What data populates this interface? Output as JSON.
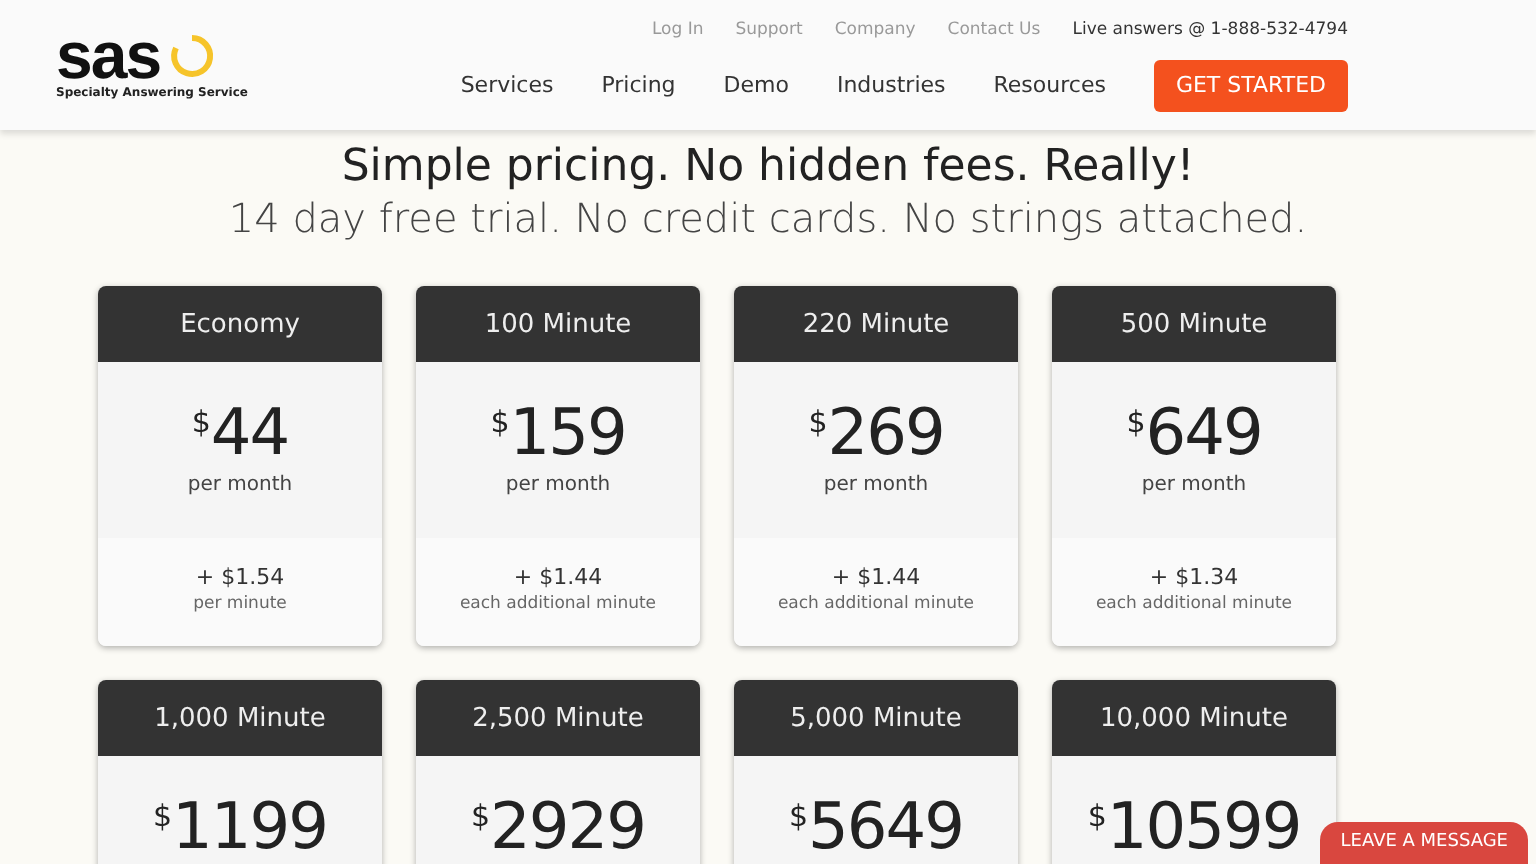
{
  "header": {
    "logo_text": "sas",
    "logo_tagline": "Specialty Answering Service",
    "top_links": [
      "Log In",
      "Support",
      "Company",
      "Contact Us"
    ],
    "phone": "Live answers @ 1-888-532-4794",
    "nav": [
      "Services",
      "Pricing",
      "Demo",
      "Industries",
      "Resources"
    ],
    "cta": "GET STARTED"
  },
  "hero": {
    "title": "Simple pricing. No hidden fees. Really!",
    "subtitle": "14 day free trial. No credit cards. No strings attached."
  },
  "plans": [
    {
      "name": "Economy",
      "currency": "$",
      "price": "44",
      "period": "per month",
      "extra": "+ $1.54",
      "extra_note": "per minute"
    },
    {
      "name": "100 Minute",
      "currency": "$",
      "price": "159",
      "period": "per month",
      "extra": "+ $1.44",
      "extra_note": "each additional minute"
    },
    {
      "name": "220 Minute",
      "currency": "$",
      "price": "269",
      "period": "per month",
      "extra": "+ $1.44",
      "extra_note": "each additional minute"
    },
    {
      "name": "500 Minute",
      "currency": "$",
      "price": "649",
      "period": "per month",
      "extra": "+ $1.34",
      "extra_note": "each additional minute"
    },
    {
      "name": "1,000 Minute",
      "currency": "$",
      "price": "1199"
    },
    {
      "name": "2,500 Minute",
      "currency": "$",
      "price": "2929"
    },
    {
      "name": "5,000 Minute",
      "currency": "$",
      "price": "5649"
    },
    {
      "name": "10,000 Minute",
      "currency": "$",
      "price": "10599"
    }
  ],
  "chat_button": "LEAVE A MESSAGE"
}
